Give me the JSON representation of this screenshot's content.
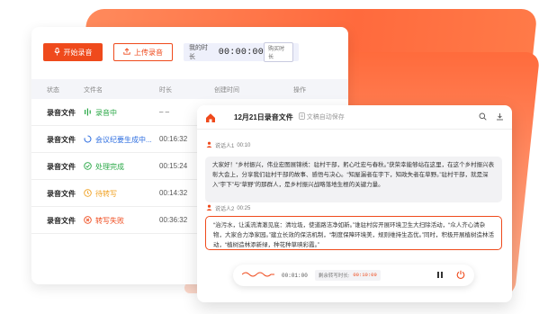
{
  "toolbar": {
    "start_label": "开始录音",
    "upload_label": "上传录音",
    "duration_label": "我的时长",
    "duration_value": "00:00:00",
    "buy_label": "购买时长"
  },
  "table": {
    "headers": [
      "状态",
      "文件名",
      "时长",
      "创建时间",
      "操作"
    ],
    "rows": [
      {
        "type": "录音文件",
        "status": "录音中",
        "status_color": "#28a745",
        "status_icon": "waveform-icon",
        "time": "– –"
      },
      {
        "type": "录音文件",
        "status": "会议纪要生成中...",
        "status_color": "#2f6fe0",
        "status_icon": "spinner-icon",
        "time": "00:16:32"
      },
      {
        "type": "录音文件",
        "status": "处理完成",
        "status_color": "#28a745",
        "status_icon": "check-circle-icon",
        "time": "00:15:24"
      },
      {
        "type": "录音文件",
        "status": "待转写",
        "status_color": "#f0a020",
        "status_icon": "clock-icon",
        "time": "00:14:32"
      },
      {
        "type": "录音文件",
        "status": "转写失败",
        "status_color": "#ef4a1c",
        "status_icon": "x-circle-icon",
        "time": "00:36:32"
      }
    ]
  },
  "detail": {
    "title": "12月21日录音文件",
    "autosave": "文稿自动保存",
    "speaker1": {
      "name": "说话人1",
      "time": "00:10"
    },
    "text1": "大家好！“乡村振兴，伟业宏图展锦绣：驻村干部，躬心吐宏与春秋。”获荣幸能够站在这里，在这个乡村振兴表彰大会上，分享我们驻村干部的故事、感悟与决心。“知屋漏者在宇下，知政失者在草野。”驻村干部，就是深入“宇下”与“草野”的那群人，是乡村振兴战略落地生根的关键力量。",
    "speaker2": {
      "name": "说话人2",
      "time": "00:25"
    },
    "text2": "“治污水，让溪流清澈见底：清垃圾，使道路洁净如新。”谁驻村房开展环境卫生大扫除活动，“众人齐心清杂物，大家合力净家园。”建立长效的保洁机制，“制度保障环境美，规则维持生态优。”同时，积极开展植树造林活动，“植树造林添新绿，种花种草映彩霞。”",
    "player_time": "00:01:00",
    "remain_label": "剩余转写时长:",
    "remain_time": "00:10:09"
  },
  "colors": {
    "accent": "#ef4a1c"
  }
}
